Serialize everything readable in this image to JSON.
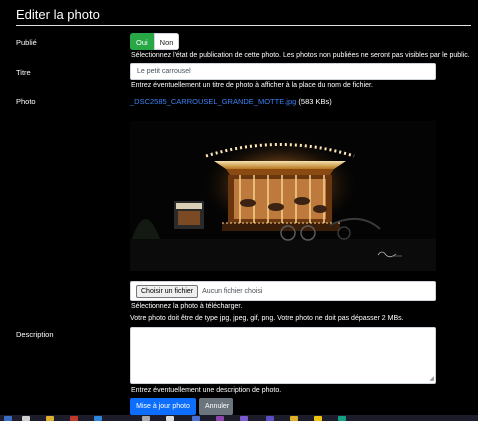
{
  "page": {
    "title": "Editer la photo"
  },
  "published": {
    "label": "Publié",
    "option_yes": "Oui",
    "option_no": "Non",
    "help": "Sélectionnez l'état de publication de cette photo. Les photos non publiées ne seront pas visibles par le public."
  },
  "titre": {
    "label": "Titre",
    "value": "Le petit carrousel",
    "help": "Entrez éventuellement un titre de photo à afficher à la place du nom de fichier."
  },
  "photo": {
    "label": "Photo",
    "filename": "_DSC2585_CARROUSEL_GRANDE_MOTTE.jpg",
    "size": "(583 KBs)",
    "image_alt": "carousel-night-photo",
    "choose_button": "Choisir un fichier",
    "no_file": "Aucun fichier choisi",
    "help_select": "Sélectionnez la photo à télécharger.",
    "help_format": "Votre photo doit être de type jpg, jpeg, gif, png. Votre photo ne doit pas dépasser 2 MBs."
  },
  "description": {
    "label": "Description",
    "value": "",
    "help": "Entrez éventuellement une description de photo."
  },
  "actions": {
    "update": "Mise à jour photo",
    "cancel": "Annuler"
  },
  "colors": {
    "active_toggle": "#28a745",
    "primary": "#0d6efd",
    "secondary": "#6c757d",
    "link": "#3b82f6"
  }
}
